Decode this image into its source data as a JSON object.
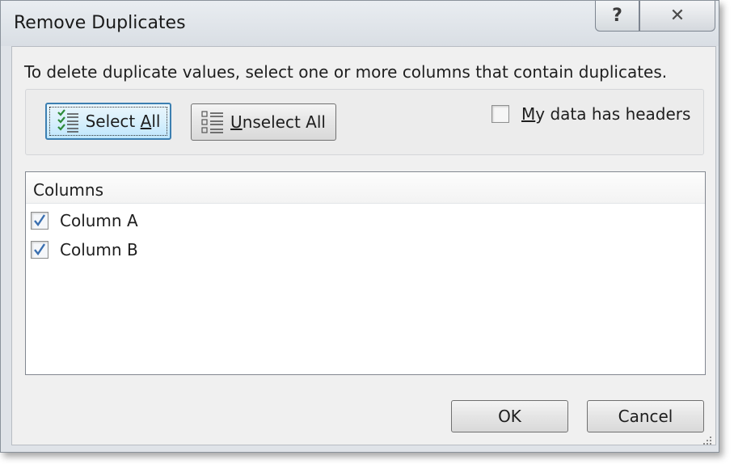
{
  "window": {
    "title": "Remove Duplicates",
    "help_glyph": "?",
    "close_glyph": "✕"
  },
  "instructions": "To delete duplicate values, select one or more columns that contain duplicates.",
  "buttons": {
    "select_all": {
      "prefix": "Select ",
      "mnemonic": "A",
      "suffix": "ll",
      "icon": "checklist-icon"
    },
    "unselect_all": {
      "prefix": "",
      "mnemonic": "U",
      "suffix": "nselect All",
      "icon": "list-icon"
    },
    "ok": "OK",
    "cancel": "Cancel"
  },
  "headers_option": {
    "mnemonic": "M",
    "suffix": "y data has headers",
    "checked": false
  },
  "columns": {
    "header": "Columns",
    "items": [
      {
        "label": "Column A",
        "checked": true
      },
      {
        "label": "Column B",
        "checked": true
      }
    ]
  },
  "colors": {
    "accent_focus": "#3c7fb1",
    "check_green": "#2e8b3a",
    "check_mark": "#3a6fb0"
  }
}
